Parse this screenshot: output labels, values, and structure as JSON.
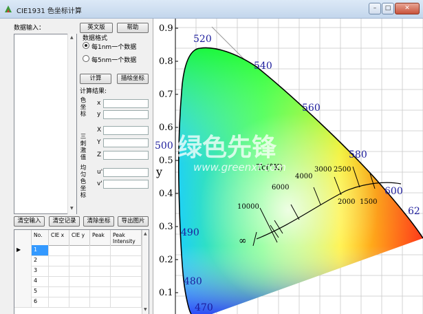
{
  "window": {
    "title": "CIE1931 色坐标计算"
  },
  "input": {
    "label": "数据输入："
  },
  "buttons": {
    "english": "英文版",
    "help": "帮助",
    "compute": "计算",
    "plot": "描绘坐标",
    "clear_input": "清空输入",
    "clear_record": "清空记录",
    "clear_coord": "清除坐标",
    "export_image": "导出图片"
  },
  "format": {
    "label": "数据格式",
    "option1": "每1nm一个数据",
    "option2": "每5nm一个数据",
    "selected": "option1"
  },
  "result": {
    "label": "计算结果:",
    "group1": "色坐标",
    "x": "x",
    "y": "y",
    "group2": "三刺激值",
    "X": "X",
    "Y": "Y",
    "Z": "Z",
    "group3": "均匀色坐标",
    "u": "u'",
    "v": "v'"
  },
  "table": {
    "headers": [
      "No.",
      "CIE x",
      "CIE y",
      "Peak",
      "Peak Intensity"
    ],
    "rows": [
      "1",
      "2",
      "3",
      "4",
      "5",
      "6"
    ]
  },
  "plot": {
    "yticks": [
      "0.9",
      "0.8",
      "0.7",
      "0.6",
      "0.5",
      "0.4",
      "0.3",
      "0.2",
      "0.1"
    ],
    "ylabel": "y",
    "wavelengths": [
      "520",
      "540",
      "560",
      "580",
      "600",
      "62",
      "500",
      "490",
      "480",
      "470"
    ],
    "temps": [
      "10000",
      "6000",
      "4000",
      "3000",
      "2500",
      "2000",
      "1500",
      "∞"
    ],
    "tc_label": "Tc(°K)",
    "watermark_cn": "绿色先锋",
    "watermark_url": "www.greenxf.com"
  }
}
